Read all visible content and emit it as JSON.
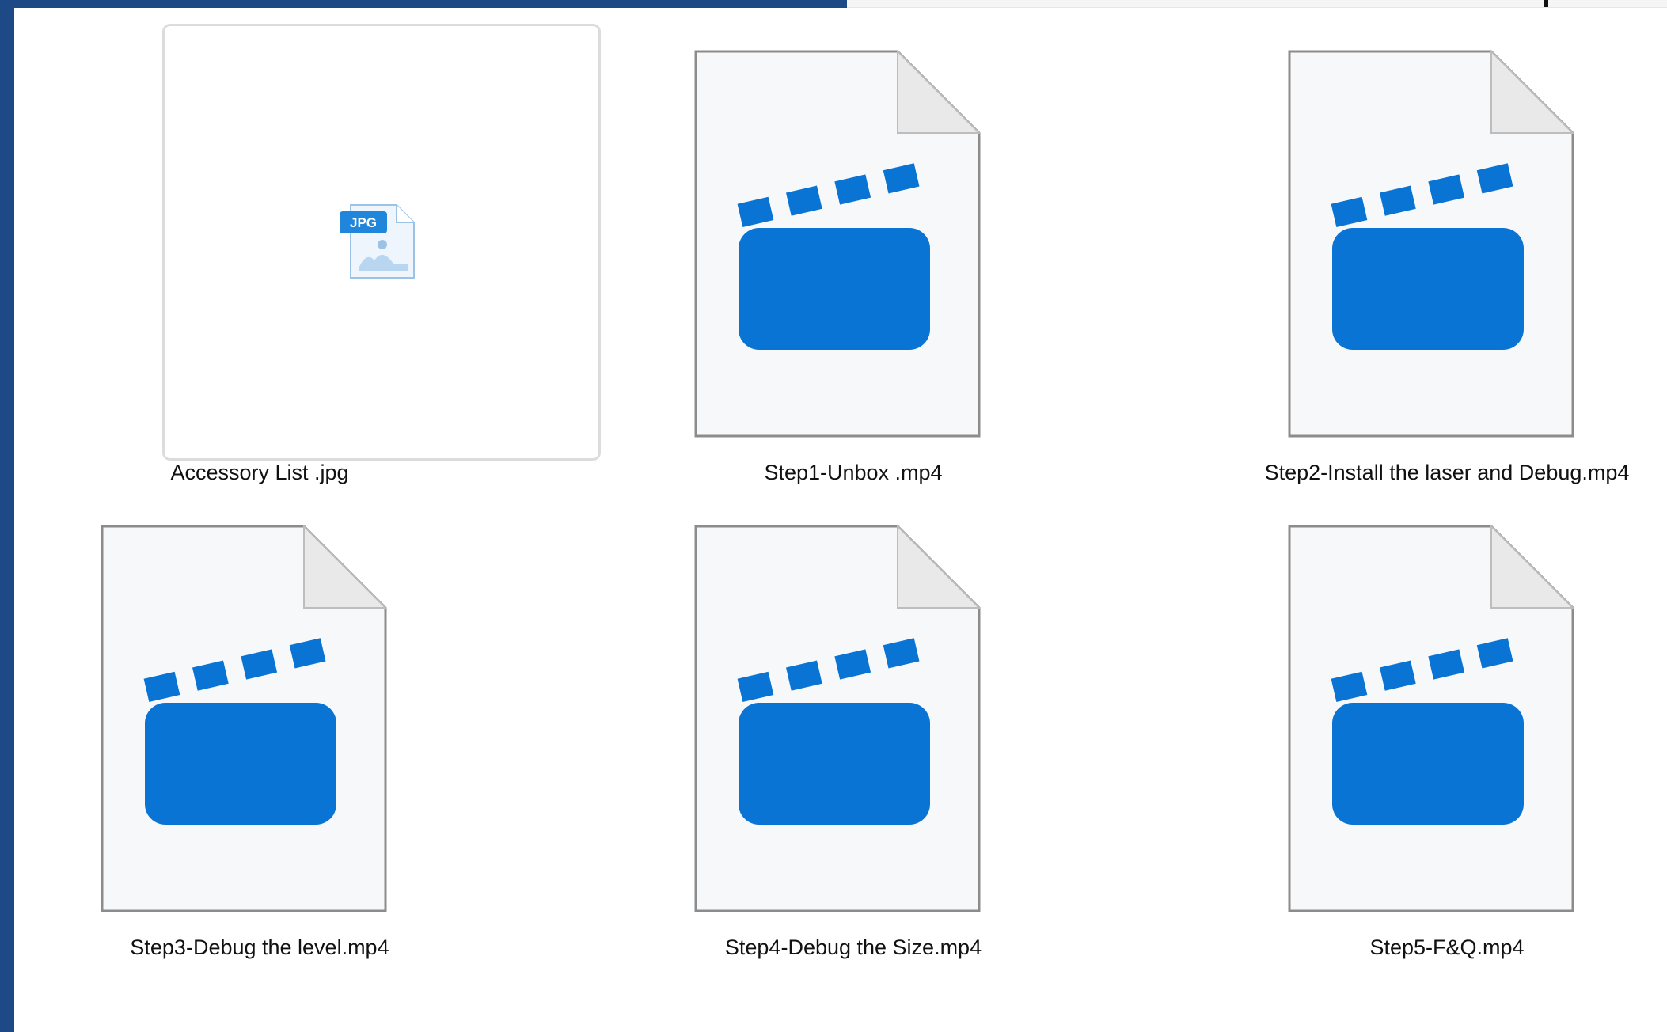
{
  "files": [
    {
      "name": "Accessory List .jpg",
      "icon": "jpg-file-icon",
      "badge": "JPG"
    },
    {
      "name": "Step1-Unbox .mp4",
      "icon": "video-clapperboard-icon"
    },
    {
      "name": "Step2-Install the laser and Debug.mp4",
      "icon": "video-clapperboard-icon"
    },
    {
      "name": "Step3-Debug the level.mp4",
      "icon": "video-clapperboard-icon"
    },
    {
      "name": "Step4-Debug the Size.mp4",
      "icon": "video-clapperboard-icon"
    },
    {
      "name": "Step5-F&Q.mp4",
      "icon": "video-clapperboard-icon"
    }
  ],
  "colors": {
    "accent": "#0a74d4",
    "window_frame": "#1d4a86",
    "document_fill": "#f7f8fa",
    "document_outline": "#8c8c8c"
  }
}
